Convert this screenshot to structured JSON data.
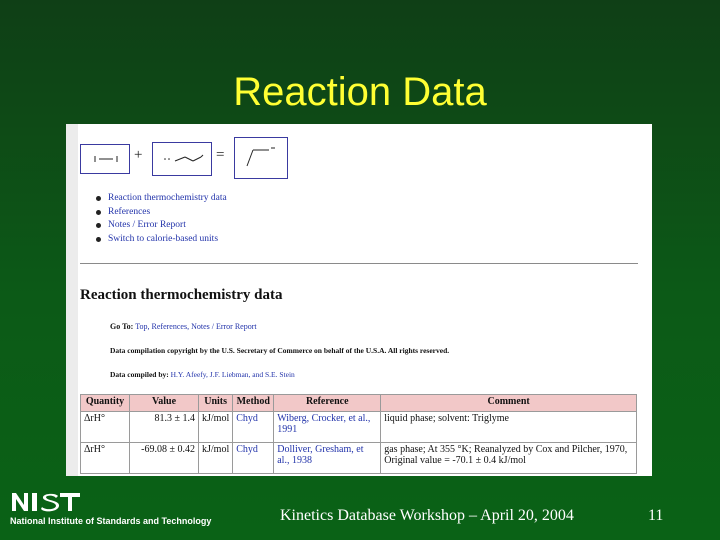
{
  "slide": {
    "title": "Reaction Data",
    "footer_text": "Kinetics Database Workshop – April 20, 2004",
    "page_number": "11"
  },
  "nist": {
    "logo_text": "NIST",
    "institute": "National Institute of Standards and Technology"
  },
  "reaction": {
    "plus": "+",
    "equals": "="
  },
  "links": [
    "Reaction thermochemistry data",
    "References",
    "Notes / Error Report",
    "Switch to calorie-based units"
  ],
  "section": {
    "heading": "Reaction thermochemistry data",
    "goto_label": "Go To:",
    "goto_links": "Top, References, Notes / Error Report",
    "copyright": "Data compilation copyright by the U.S. Secretary of Commerce on behalf of the U.S.A. All rights reserved.",
    "compiled_label": "Data compiled by:",
    "compiled_by": "H.Y. Afeefy, J.F. Liebman, and S.E. Stein"
  },
  "table": {
    "headers": [
      "Quantity",
      "Value",
      "Units",
      "Method",
      "Reference",
      "Comment"
    ],
    "rows": [
      {
        "quantity": "ΔrH°",
        "value": "81.3 ± 1.4",
        "units": "kJ/mol",
        "method": "Chyd",
        "reference": "Wiberg, Crocker, et al., 1991",
        "comment": "liquid phase; solvent: Triglyme"
      },
      {
        "quantity": "ΔrH°",
        "value": "-69.08 ± 0.42",
        "units": "kJ/mol",
        "method": "Chyd",
        "reference": "Dolliver, Gresham, et al., 1938",
        "comment": "gas phase; At 355 °K; Reanalyzed by Cox and Pilcher, 1970, Original value = -70.1 ± 0.4 kJ/mol"
      }
    ]
  }
}
